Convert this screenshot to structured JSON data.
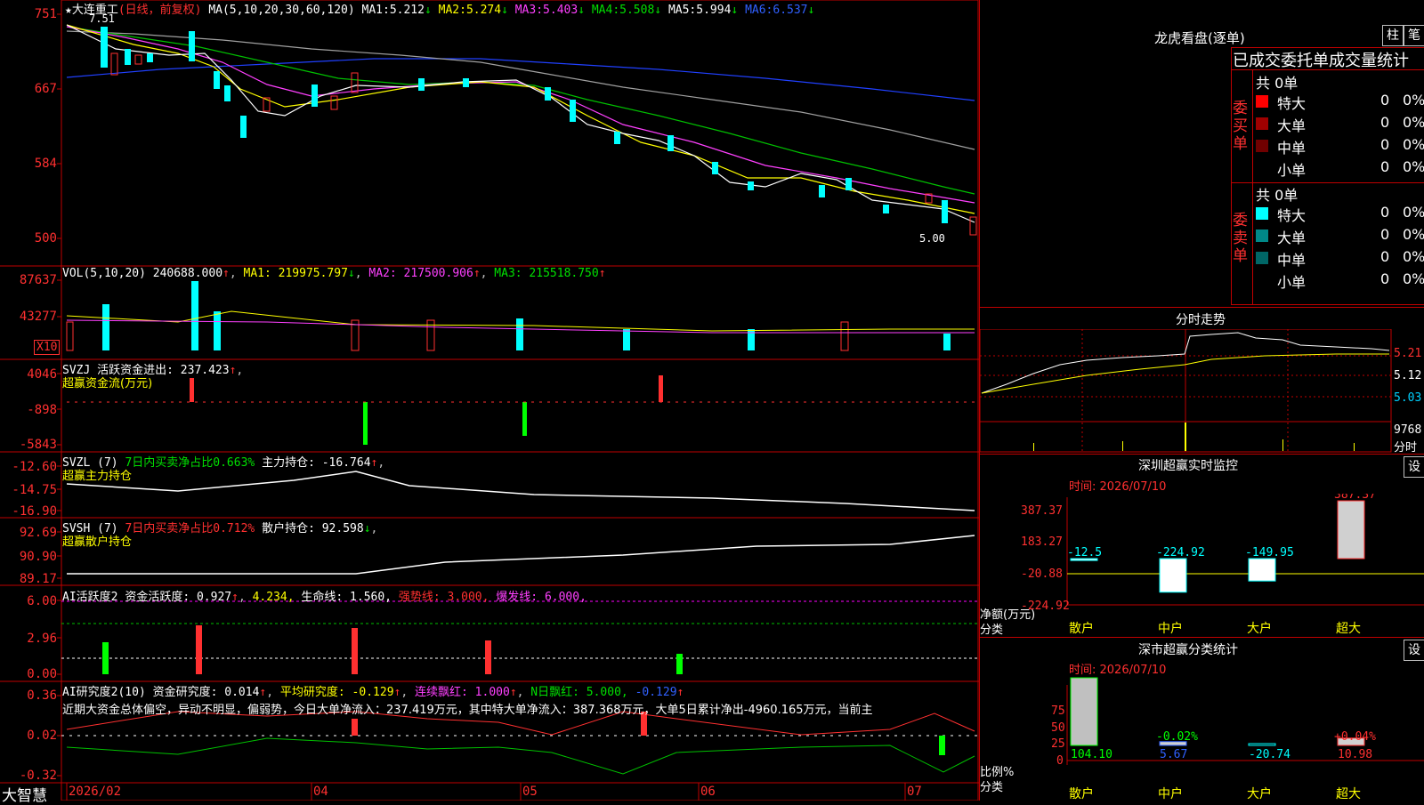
{
  "main": {
    "stock_title": "★大连重工",
    "period": "(日线，前复权)",
    "ma_label": "MA(5,10,20,30,60,120)",
    "ma_values": [
      {
        "label": "MA1:",
        "value": "5.212",
        "arrow": "↓",
        "color": "#ffffff"
      },
      {
        "label": "MA2:",
        "value": "5.274",
        "arrow": "↓",
        "color": "#ffff00"
      },
      {
        "label": "MA3:",
        "value": "5.403",
        "arrow": "↓",
        "color": "#ff40ff"
      },
      {
        "label": "MA4:",
        "value": "5.508",
        "arrow": "↓",
        "color": "#00e000"
      },
      {
        "label": "MA5:",
        "value": "5.994",
        "arrow": "↓",
        "color": "#c0c0c0"
      },
      {
        "label": "MA6:",
        "value": "6.537",
        "arrow": "↓",
        "color": "#3060ff"
      }
    ],
    "y_labels": [
      "751",
      "667",
      "584",
      "500"
    ],
    "high_marker": "7.51",
    "low_marker": "5.00"
  },
  "vol": {
    "header": "VOL(5,10,20)",
    "value": "240688.000",
    "ma1": "MA1: 219975.797",
    "ma2": "MA2: 217500.906",
    "ma3": "MA3: 215518.750",
    "y_labels": [
      "87637",
      "43277"
    ],
    "unit": "X10"
  },
  "svzj": {
    "name": "SVZJ",
    "line1": "活跃资金进出: 237.423",
    "line2": "超赢资金流(万元)",
    "y_labels": [
      "4046",
      "-898",
      "-5843"
    ]
  },
  "svzl": {
    "name": "SVZL (7)",
    "red_text": "7日内买卖净占比0.663%",
    "main_text": "主力持仓: -16.764",
    "line2": "超赢主力持仓",
    "y_labels": [
      "-12.60",
      "-14.75",
      "-16.90"
    ]
  },
  "svsh": {
    "name": "SVSH (7)",
    "red_text": "7日内买卖净占比0.712%",
    "main_text": "散户持仓: 92.598",
    "line2": "超赢散户持仓",
    "y_labels": [
      "92.69",
      "90.90",
      "89.17"
    ]
  },
  "ai1": {
    "name": "AI活跃度2",
    "text1": "资金活跃度: 0.927",
    "text2": "4.234,",
    "text3": "生命线: 1.560,",
    "text4": "强势线: 3.000,",
    "text5": "爆发线: 6.000,",
    "y_labels": [
      "6.00",
      "2.96",
      "0.00"
    ]
  },
  "ai2": {
    "name": "AI研究度2(10)",
    "text1": "资金研究度: 0.014",
    "text2": "平均研究度: -0.129",
    "text3": "连续飘红: 1.000",
    "text4": "N日飘红: 5.000,",
    "text5": "-0.129",
    "summary": "近期大资金总体偏空，异动不明显，偏弱势，今日大单净流入：237.419万元，其中特大单净流入：387.368万元，大单5日累计净出-4960.165万元，当前主",
    "y_labels": [
      "0.36",
      "0.02",
      "-0.32"
    ]
  },
  "bottom": {
    "brand": "大智慧",
    "dates": [
      "2026/02",
      "04",
      "05",
      "06",
      "07"
    ]
  },
  "right": {
    "title": "龙虎看盘(逐单)",
    "btn1": "柱",
    "btn2": "笔",
    "table_header": "已成交委托单成交量统计",
    "buy_label": "委买单",
    "sell_label": "委卖单",
    "buy_total": "共 0单",
    "sell_total": "共 0单",
    "buy_rows": [
      {
        "name": "特大",
        "count": "0",
        "pct": "0%",
        "color": "#ff0000"
      },
      {
        "name": "大单",
        "count": "0",
        "pct": "0%",
        "color": "#a00000"
      },
      {
        "name": "中单",
        "count": "0",
        "pct": "0%",
        "color": "#700000"
      },
      {
        "name": "小单",
        "count": "0",
        "pct": "0%",
        "color": ""
      }
    ],
    "sell_rows": [
      {
        "name": "特大",
        "count": "0",
        "pct": "0%",
        "color": "#00ffff"
      },
      {
        "name": "大单",
        "count": "0",
        "pct": "0%",
        "color": "#008888"
      },
      {
        "name": "中单",
        "count": "0",
        "pct": "0%",
        "color": "#006666"
      },
      {
        "name": "小单",
        "count": "0",
        "pct": "0%",
        "color": ""
      }
    ],
    "intraday_title": "分时走势",
    "intraday_prices": [
      "5.21",
      "5.12",
      "5.03"
    ],
    "intraday_vol": "9768",
    "intraday_label": "分时",
    "monitor_title": "深圳超赢实时监控",
    "monitor_time": "时间: 2026/07/10",
    "monitor_ylabels": [
      "387.37",
      "183.27",
      "-20.88",
      "-224.92"
    ],
    "monitor_yaxis": "净额(万元)",
    "category_label": "分类",
    "categories": [
      "散户",
      "中户",
      "大户",
      "超大"
    ],
    "stats_title": "深市超赢分类统计",
    "stats_time": "时间: 2026/07/10",
    "stats_ylabels": [
      "75",
      "50",
      "25",
      "0"
    ],
    "stats_yaxis": "比例%",
    "set_label": "设"
  },
  "chart_data": [
    {
      "type": "bar",
      "title": "深圳超赢实时监控",
      "ylabel": "净额(万元)",
      "categories": [
        "散户",
        "中户",
        "大户",
        "超大"
      ],
      "values": [
        -12.5,
        -224.92,
        -149.95,
        387.37
      ],
      "ylim": [
        -224.92,
        387.37
      ]
    },
    {
      "type": "bar",
      "title": "深市超赢分类统计",
      "ylabel": "比例%",
      "categories": [
        "散户",
        "中户",
        "大户",
        "超大"
      ],
      "values": [
        104.1,
        5.67,
        -20.74,
        10.98
      ],
      "annotations": [
        "-0.02%",
        "+0.04%"
      ]
    }
  ]
}
